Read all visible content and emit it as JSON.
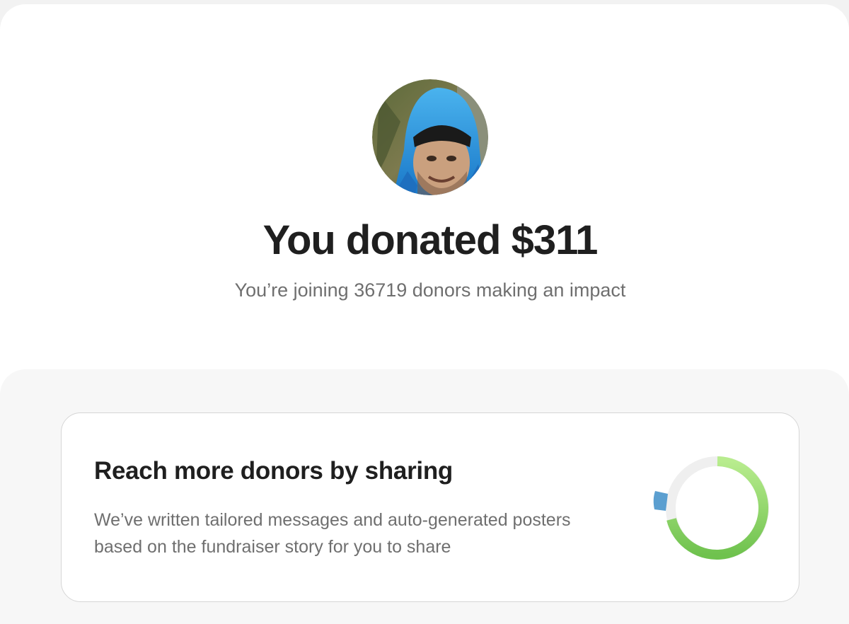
{
  "donation": {
    "headline": "You donated $311",
    "subline": "You’re joining 36719 donors making an impact"
  },
  "share_card": {
    "title": "Reach more donors by sharing",
    "description": "We’ve written tailored messages and auto-generated posters based on the fundraiser story for you to share"
  },
  "icons": {
    "avatar": "profile-photo",
    "progress": "donut-progress-icon"
  },
  "colors": {
    "ring_green": "#8fd46a",
    "ring_blue": "#5b9fd0",
    "ring_track": "#efefef"
  }
}
